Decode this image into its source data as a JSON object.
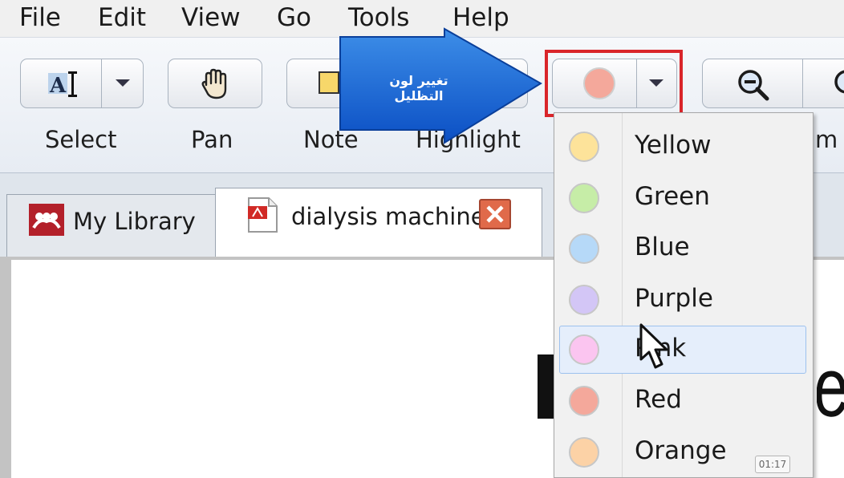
{
  "menu": [
    "File",
    "Edit",
    "View",
    "Go",
    "Tools",
    "Help"
  ],
  "toolbar": {
    "select_label": "Select",
    "pan_label": "Pan",
    "note_label": "Note",
    "highlight_label": "Highlight",
    "zoom_label_partial": "m",
    "current_color": "#f4a89b"
  },
  "callout": {
    "text": "تغيير لون التظليل"
  },
  "tabs": [
    {
      "label": "My Library",
      "active": false
    },
    {
      "label": "dialysis machine",
      "active": true
    }
  ],
  "color_menu": [
    {
      "label": "Yellow",
      "color": "#fde39a"
    },
    {
      "label": "Green",
      "color": "#c6eda7"
    },
    {
      "label": "Blue",
      "color": "#b6d9f8"
    },
    {
      "label": "Purple",
      "color": "#d3c6f6"
    },
    {
      "label": "Pink",
      "color": "#fbc5f0"
    },
    {
      "label": "Red",
      "color": "#f4a89b"
    },
    {
      "label": "Orange",
      "color": "#fcd2a6"
    }
  ],
  "timestamp": "01:17"
}
